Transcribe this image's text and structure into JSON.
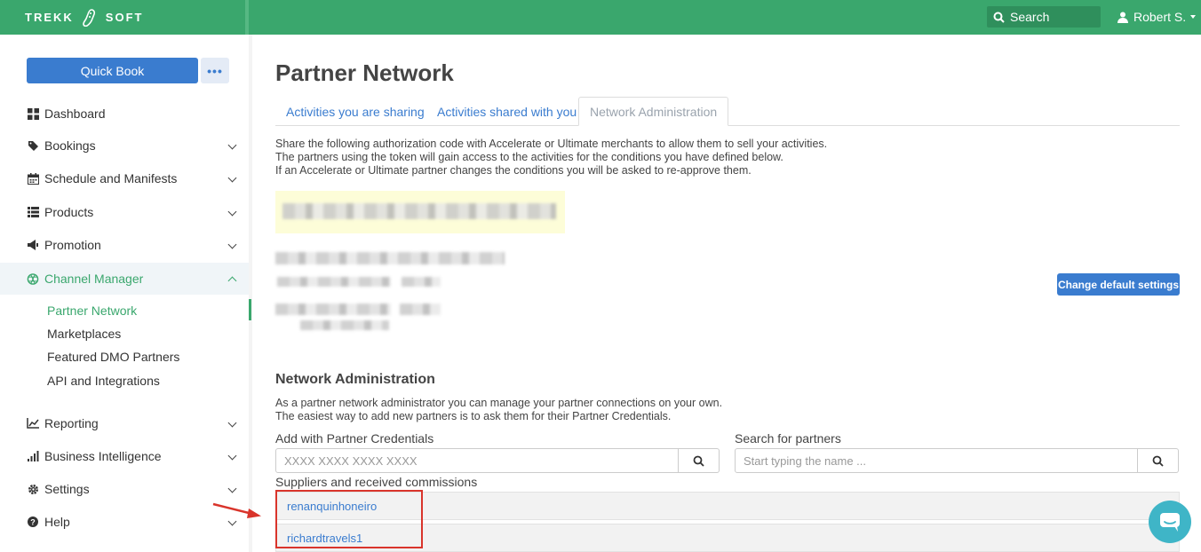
{
  "header": {
    "logo_left": "TREKK",
    "logo_right": "SOFT",
    "search_label": "Search",
    "user_name": "Robert S."
  },
  "sidebar": {
    "quick_book": "Quick Book",
    "more": "•••",
    "items": [
      {
        "label": "Dashboard",
        "icon": "dashboard-icon"
      },
      {
        "label": "Bookings",
        "icon": "tag-icon"
      },
      {
        "label": "Schedule and Manifests",
        "icon": "calendar-icon"
      },
      {
        "label": "Products",
        "icon": "list-icon"
      },
      {
        "label": "Promotion",
        "icon": "megaphone-icon"
      },
      {
        "label": "Channel Manager",
        "icon": "network-icon"
      },
      {
        "label": "Reporting",
        "icon": "line-chart-icon"
      },
      {
        "label": "Business Intelligence",
        "icon": "bar-chart-icon"
      },
      {
        "label": "Settings",
        "icon": "gear-icon"
      },
      {
        "label": "Help",
        "icon": "question-icon"
      }
    ],
    "sub_items": [
      "Partner Network",
      "Marketplaces",
      "Featured DMO Partners",
      "API and Integrations"
    ]
  },
  "main": {
    "title": "Partner Network",
    "tabs": [
      "Activities you are sharing",
      "Activities shared with you",
      "Network Administration"
    ],
    "info_lines": [
      "Share the following authorization code with Accelerate or Ultimate merchants to allow them to sell your activities.",
      "The partners using the token will gain access to the activities for the conditions you have defined below.",
      "If an Accelerate or Ultimate partner changes the conditions you will be asked to re-approve them."
    ],
    "change_button": "Change default settings",
    "section_title": "Network Administration",
    "section_lines": [
      "As a partner network administrator you can manage your partner connections on your own.",
      "The easiest way to add new partners is to ask them for their Partner Credentials."
    ],
    "credentials_label": "Add with Partner Credentials",
    "credentials_placeholder": "XXXX XXXX XXXX XXXX",
    "search_label": "Search for partners",
    "search_placeholder": "Start typing the name ...",
    "list_label": "Suppliers and received commissions",
    "suppliers": [
      "renanquinhoneiro",
      "richardtravels1"
    ]
  },
  "colors": {
    "brand_green": "#3aa76d",
    "accent_blue": "#3a7ccf",
    "highlight_red": "#d9342b"
  }
}
